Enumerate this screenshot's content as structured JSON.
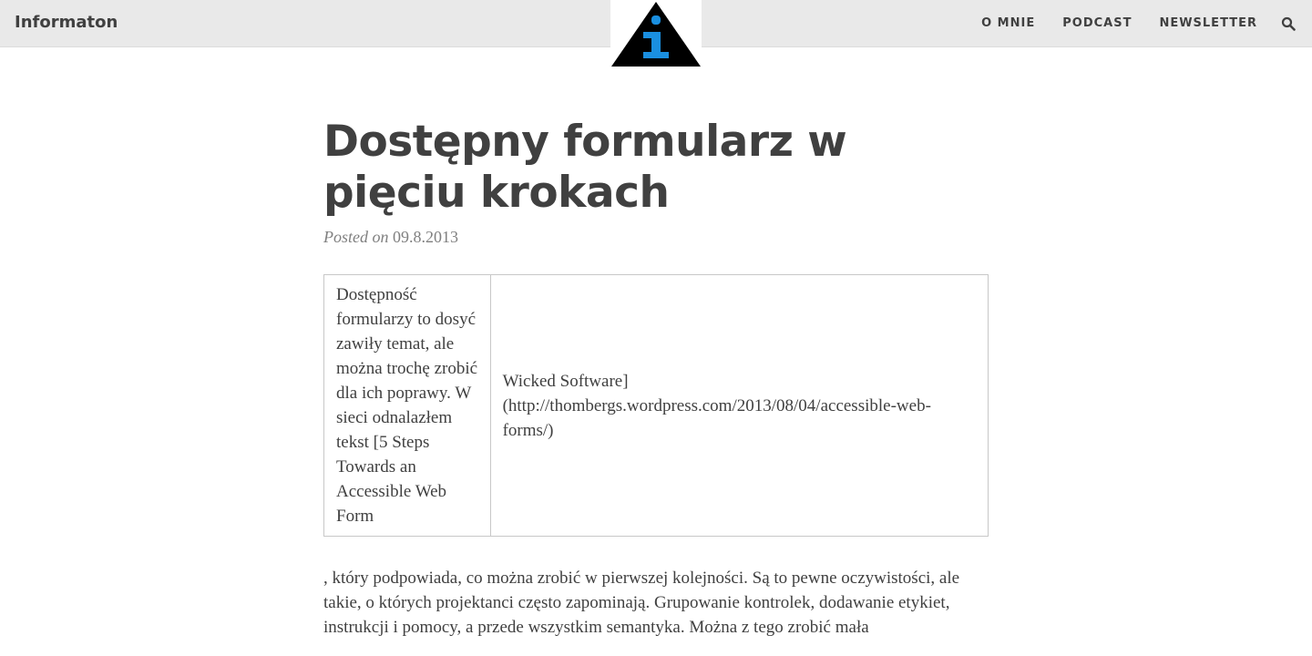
{
  "header": {
    "site_name": "Informaton",
    "nav": [
      "O MNIE",
      "PODCAST",
      "NEWSLETTER"
    ],
    "logo_icon": "info-triangle-icon",
    "search_icon": "search-icon",
    "colors": {
      "bar": "#e9e9e9",
      "logo_accent": "#1a8fe0"
    }
  },
  "post": {
    "title": "Dostępny formularz w pięciu krokach",
    "meta_label": "Posted on",
    "date": "09.8.2013",
    "table": {
      "cell1": "Dostępność formularzy to dosyć zawiły temat, ale można trochę zrobić dla ich poprawy. W sieci odnalazłem tekst [5 Steps Towards an Accessible Web Form",
      "cell2": "Wicked Software](http://thombergs.wordpress.com/2013/08/04/accessible-web-forms/)"
    },
    "paragraph": ", który podpowiada, co można zrobić w pierwszej kolejności. Są to pewne oczywistości, ale takie, o których projektanci często zapominają. Grupowanie kontrolek, dodawanie etykiet, instrukcji i pomocy, a przede wszystkim semantyka. Można z tego zrobić mała"
  }
}
